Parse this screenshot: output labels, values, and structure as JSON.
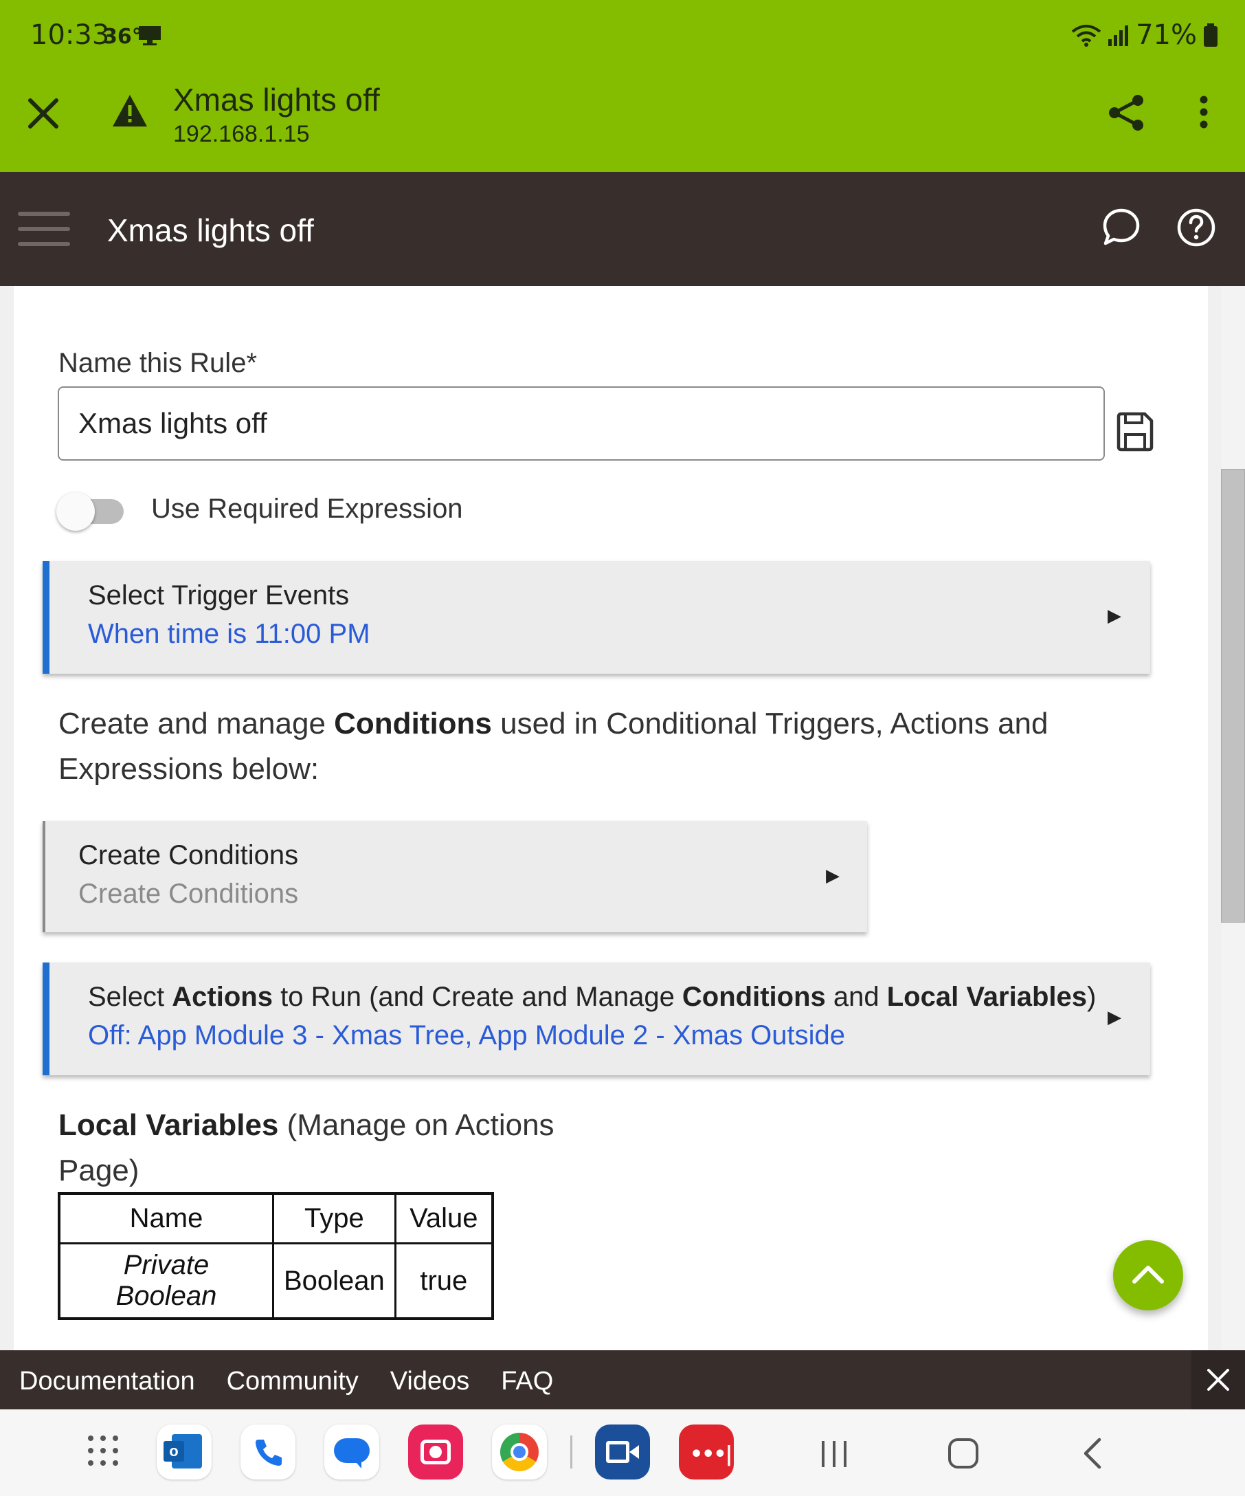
{
  "status_bar": {
    "time": "10:33",
    "temperature": "36°",
    "battery": "71%"
  },
  "browser_bar": {
    "title": "Xmas lights off",
    "url": "192.168.1.15"
  },
  "app_bar": {
    "title": "Xmas lights off"
  },
  "form": {
    "name_label": "Name this Rule*",
    "name_value": "Xmas lights off",
    "required_expression_label": "Use Required Expression",
    "required_expression_on": false
  },
  "trigger_panel": {
    "title": "Select Trigger Events",
    "subtitle": "When time is 11:00 PM"
  },
  "conditions_text": {
    "prefix": "Create and manage ",
    "bold": "Conditions",
    "suffix": " used in Conditional Triggers, Actions and Expressions below:"
  },
  "conditions_panel": {
    "title": "Create Conditions",
    "subtitle": "Create Conditions"
  },
  "actions_panel": {
    "t1": "Select ",
    "b1": "Actions",
    "t2": " to Run (and Create and Manage ",
    "b2": "Conditions",
    "t3": " and ",
    "b3": "Local Variables",
    "t4": ")",
    "subtitle": "Off: App Module 3 - Xmas Tree, App Module 2 - Xmas Outside"
  },
  "local_variables": {
    "heading_bold": "Local Variables",
    "heading_rest": " (Manage on Actions Page)",
    "columns": [
      "Name",
      "Type",
      "Value"
    ],
    "rows": [
      {
        "name": "Private Boolean",
        "type": "Boolean",
        "value": "true"
      }
    ]
  },
  "footer": {
    "links": [
      "Documentation",
      "Community",
      "Videos",
      "FAQ"
    ]
  },
  "colors": {
    "accent_green": "#84bd00",
    "header_dark": "#382f2d",
    "link_blue": "#2a5bd7",
    "panel_border_blue": "#1f6fd1"
  },
  "dock_apps": [
    "app-drawer-icon",
    "outlook-icon",
    "phone-icon",
    "messages-icon",
    "camera-icon",
    "chrome-icon",
    "video-call-icon",
    "more-apps-icon"
  ]
}
